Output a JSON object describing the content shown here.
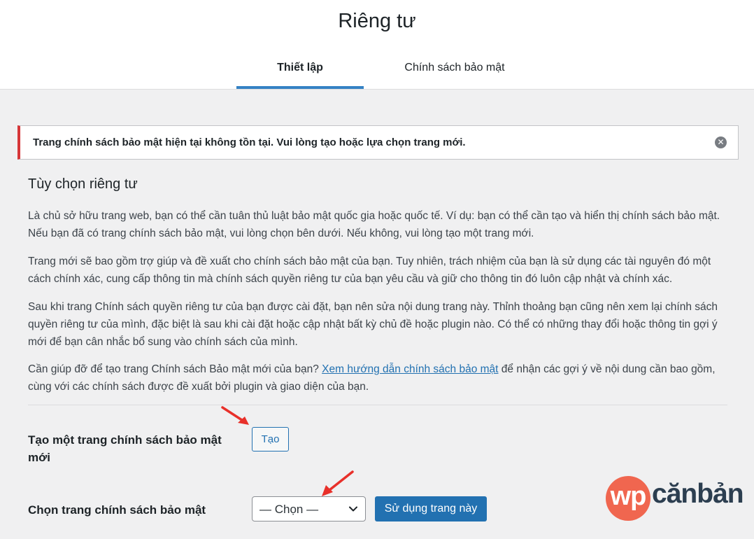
{
  "header": {
    "title": "Riêng tư",
    "tabs": [
      {
        "label": "Thiết lập",
        "active": true
      },
      {
        "label": "Chính sách bảo mật",
        "active": false
      }
    ]
  },
  "notice": {
    "text": "Trang chính sách bảo mật hiện tại không tồn tại. Vui lòng tạo hoặc lựa chọn trang mới.",
    "dismiss_icon": "close-circle-icon",
    "border_color": "#d63638"
  },
  "main": {
    "section_title": "Tùy chọn riêng tư",
    "paragraphs": [
      "Là chủ sở hữu trang web, bạn có thể cần tuân thủ luật bảo mật quốc gia hoặc quốc tế. Ví dụ: bạn có thể cần tạo và hiển thị chính sách bảo mật. Nếu bạn đã có trang chính sách bảo mật, vui lòng chọn bên dưới. Nếu không, vui lòng tạo một trang mới.",
      "Trang mới sẽ bao gồm trợ giúp và đề xuất cho chính sách bảo mật của bạn. Tuy nhiên, trách nhiệm của bạn là sử dụng các tài nguyên đó một cách chính xác, cung cấp thông tin mà chính sách quyền riêng tư của bạn yêu cầu và giữ cho thông tin đó luôn cập nhật và chính xác.",
      "Sau khi trang Chính sách quyền riêng tư của bạn được cài đặt, bạn nên sửa nội dung trang này. Thỉnh thoảng bạn cũng nên xem lại chính sách quyền riêng tư của mình, đặc biệt là sau khi cài đặt hoặc cập nhật bất kỳ chủ đề hoặc plugin nào. Có thể có những thay đổi hoặc thông tin gợi ý mới để bạn cân nhắc bổ sung vào chính sách của mình."
    ],
    "help": {
      "before": "Cần giúp đỡ để tạo trang Chính sách Bảo mật mới của bạn? ",
      "link": "Xem hướng dẫn chính sách bảo mật",
      "after": " để nhận các gợi ý về nội dung cần bao gồm, cùng với các chính sách được đề xuất bởi plugin và giao diện của bạn."
    }
  },
  "create_row": {
    "label": "Tạo một trang chính sách bảo mật mới",
    "button": "Tạo"
  },
  "select_row": {
    "label": "Chọn trang chính sách bảo mật",
    "selected": "— Chọn —",
    "button": "Sử dụng trang này"
  },
  "logo": {
    "mark": "wp",
    "text": "cănbản",
    "accent_color": "#f0664f"
  },
  "colors": {
    "primary": "#2271b1",
    "tab_indicator": "#3582c4",
    "annotation_arrow": "#e8302a"
  }
}
